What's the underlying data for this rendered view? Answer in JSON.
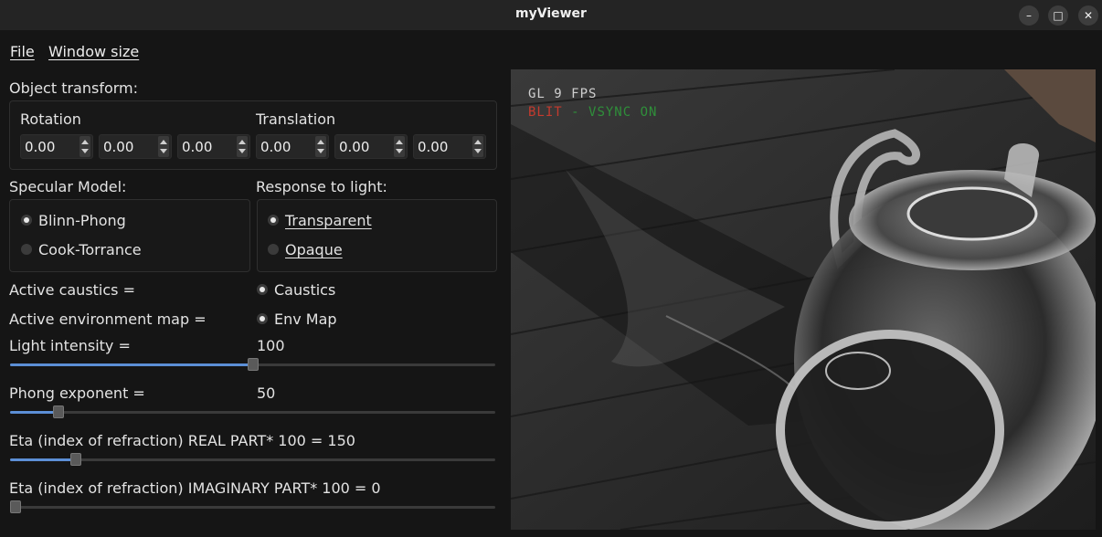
{
  "window": {
    "title": "myViewer",
    "minimize_glyph": "–",
    "maximize_glyph": "□",
    "close_glyph": "✕"
  },
  "menu": {
    "file": "File",
    "window_size": "Window size"
  },
  "transform": {
    "title": "Object transform:",
    "rotation_label": "Rotation",
    "translation_label": "Translation",
    "rotation": [
      "0.00",
      "0.00",
      "0.00"
    ],
    "translation": [
      "0.00",
      "0.00",
      "0.00"
    ]
  },
  "specular": {
    "title": "Specular Model:",
    "options": [
      "Blinn-Phong",
      "Cook-Torrance"
    ],
    "selected": 0
  },
  "response": {
    "title": "Response to light:",
    "options": [
      "Transparent",
      "Opaque"
    ],
    "selected": 0
  },
  "caustics": {
    "label": "Active caustics =",
    "toggle": "Caustics",
    "checked": true
  },
  "envmap": {
    "label": "Active environment map =",
    "toggle": "Env Map",
    "checked": true
  },
  "sliders": {
    "light": {
      "label": "Light intensity =",
      "value": "100",
      "fraction": 0.5
    },
    "phong": {
      "label": "Phong exponent =",
      "value": "50",
      "fraction": 0.1
    },
    "eta_real": {
      "label": "Eta (index of refraction) REAL PART* 100 =",
      "value": "150",
      "fraction": 0.135
    },
    "eta_imag": {
      "label": "Eta (index of refraction) IMAGINARY PART* 100 =",
      "value": "0",
      "fraction": 0.0
    }
  },
  "viewport": {
    "hud_line1": "GL 9 FPS",
    "hud_blit": "BLIT",
    "hud_dash": " - ",
    "hud_vsync": "VSYNC ON"
  },
  "colors": {
    "accent": "#5c8fd6",
    "hud_white": "#cfcfcf",
    "hud_red": "#c43a2e",
    "hud_green": "#2f8f3a"
  }
}
